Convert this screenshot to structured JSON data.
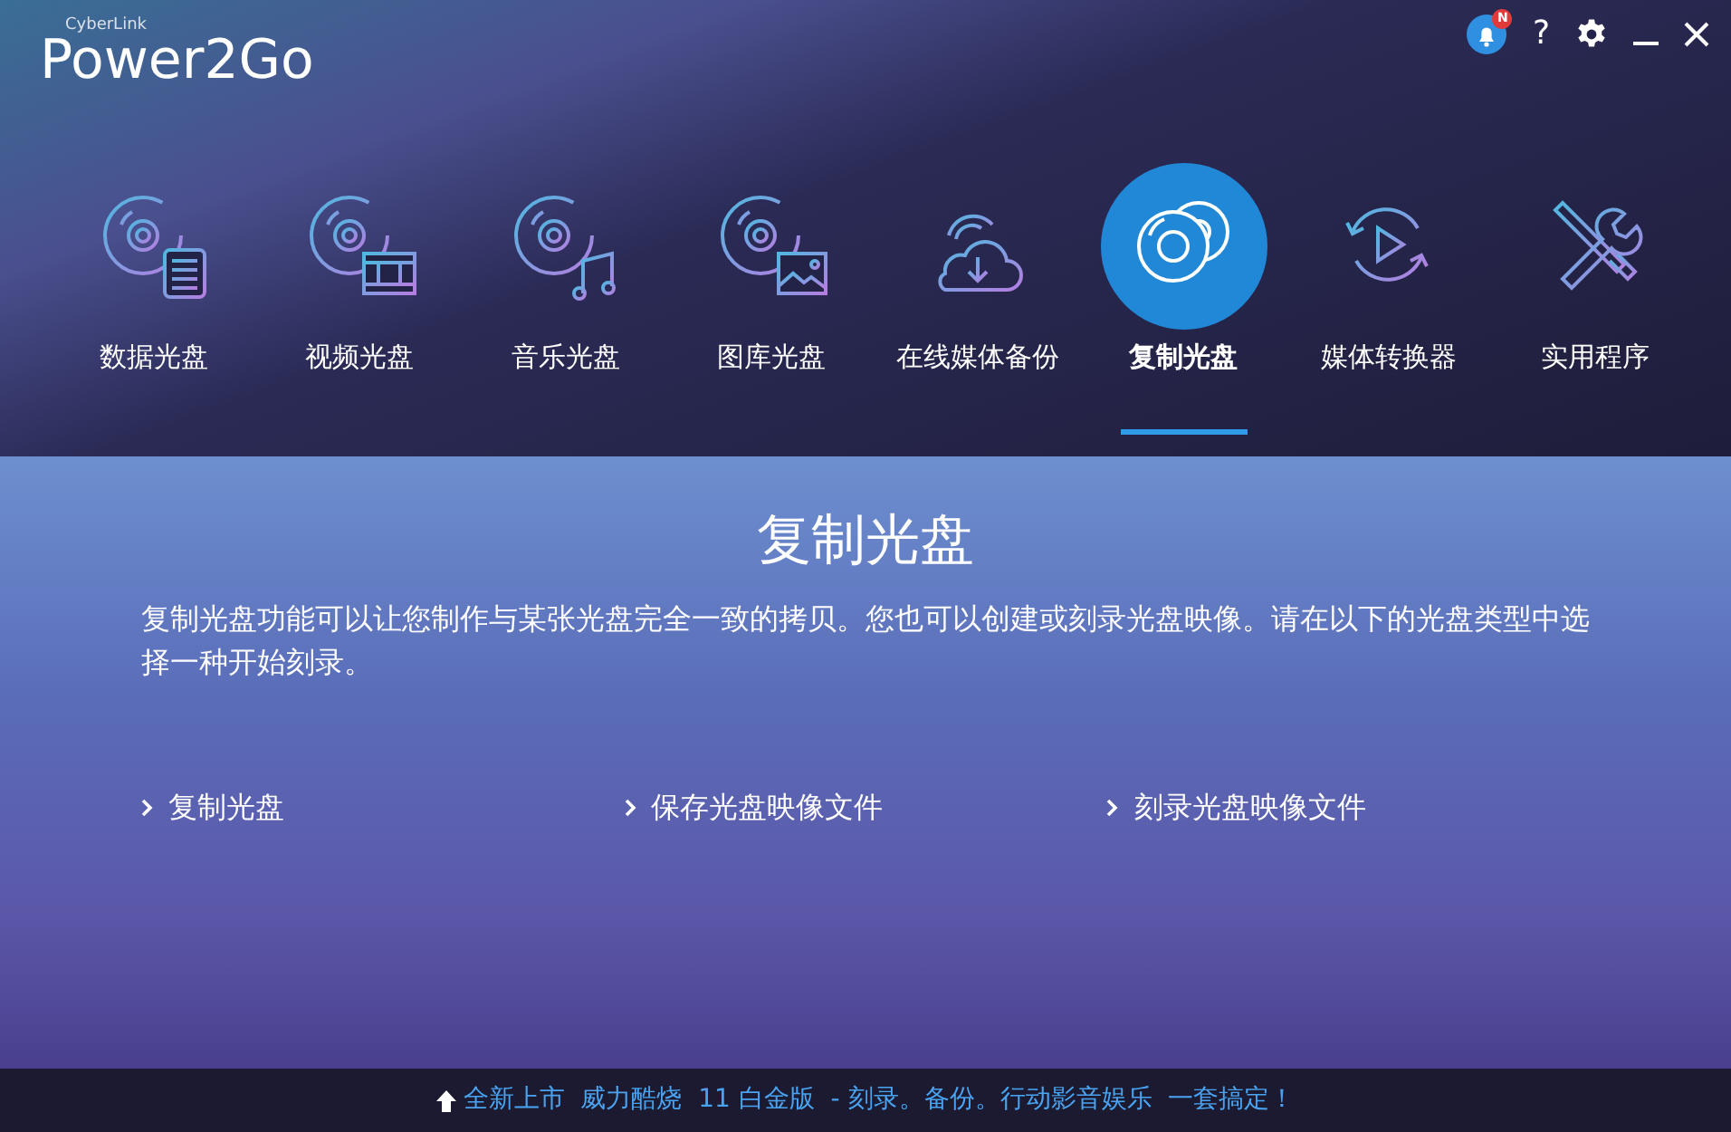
{
  "app": {
    "brand": "CyberLink",
    "title": "Power2Go"
  },
  "top_bar": {
    "notification_badge": "N",
    "help": "?"
  },
  "nav": [
    {
      "label": "数据光盘",
      "kind": "data",
      "selected": false
    },
    {
      "label": "视频光盘",
      "kind": "video",
      "selected": false
    },
    {
      "label": "音乐光盘",
      "kind": "music",
      "selected": false
    },
    {
      "label": "图库光盘",
      "kind": "photo",
      "selected": false
    },
    {
      "label": "在线媒体备份",
      "kind": "cloud",
      "selected": false
    },
    {
      "label": "复制光盘",
      "kind": "copy",
      "selected": true
    },
    {
      "label": "媒体转换器",
      "kind": "convert",
      "selected": false
    },
    {
      "label": "实用程序",
      "kind": "tools",
      "selected": false
    }
  ],
  "content": {
    "heading": "复制光盘",
    "description": "复制光盘功能可以让您制作与某张光盘完全一致的拷贝。您也可以创建或刻录光盘映像。请在以下的光盘类型中选择一种开始刻录。",
    "actions": [
      "复制光盘",
      "保存光盘映像文件",
      "刻录光盘映像文件"
    ]
  },
  "footer": {
    "text": "全新上市  威力酷烧  11 白金版  - 刻录。备份。行动影音娱乐  一套搞定！"
  }
}
